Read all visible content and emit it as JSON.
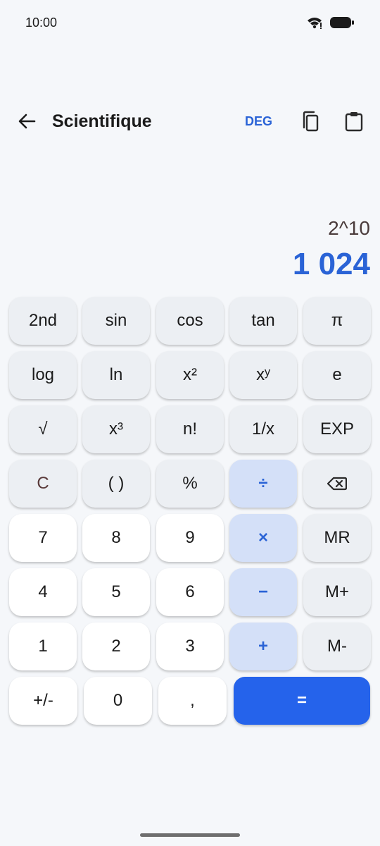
{
  "status_bar": {
    "time": "10:00",
    "wifi_icon": "wifi-icon",
    "battery_icon": "battery-icon"
  },
  "app_bar": {
    "back_icon": "arrow-left-icon",
    "title": "Scientifique",
    "angle_mode": "DEG",
    "copy_icon": "copy-icon",
    "paste_icon": "clipboard-icon"
  },
  "display": {
    "expression": "2^10",
    "result": "1 024"
  },
  "keys": {
    "row1": [
      "2nd",
      "sin",
      "cos",
      "tan",
      "π"
    ],
    "row2": [
      "log",
      "ln",
      "x²",
      "xʸ",
      "e"
    ],
    "row3": [
      "√",
      "x³",
      "n!",
      "1/x",
      "EXP"
    ],
    "row4": [
      "C",
      "( )",
      "%",
      "÷",
      "backspace"
    ],
    "row5": [
      "7",
      "8",
      "9",
      "×",
      "MR"
    ],
    "row6": [
      "4",
      "5",
      "6",
      "−",
      "M+"
    ],
    "row7": [
      "1",
      "2",
      "3",
      "+",
      "M-"
    ],
    "row8": [
      "+/-",
      "0",
      ",",
      "="
    ]
  },
  "colors": {
    "accent": "#2a63d6",
    "equals_bg": "#2563eb",
    "operator_bg": "#d4e0f8",
    "function_bg": "#eceff3",
    "digit_bg": "#ffffff",
    "background": "#f5f7fa"
  }
}
